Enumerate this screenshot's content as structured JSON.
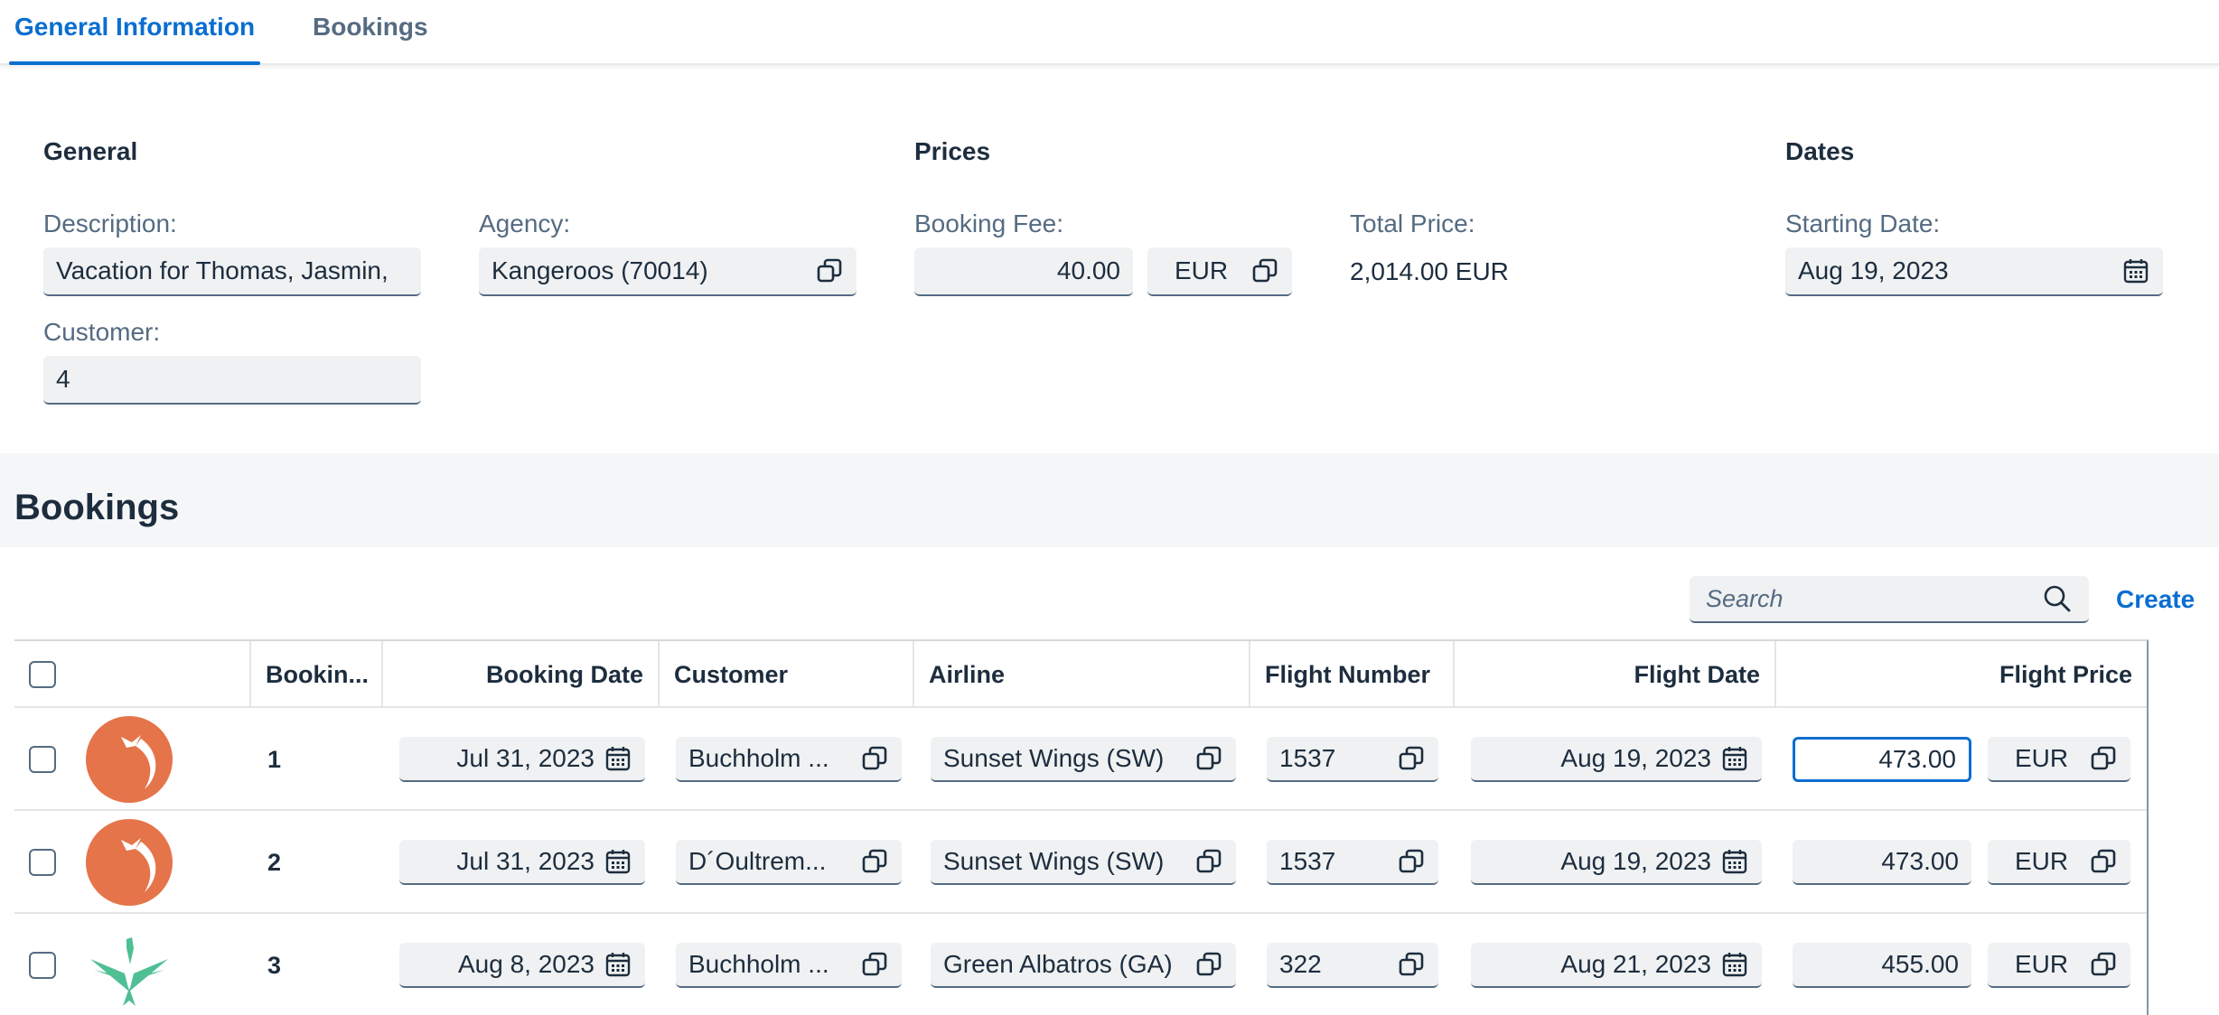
{
  "tabs": {
    "general": "General Information",
    "bookings": "Bookings"
  },
  "form": {
    "general_title": "General",
    "prices_title": "Prices",
    "dates_title": "Dates",
    "description_label": "Description:",
    "description_value": "Vacation for Thomas, Jasmin,",
    "agency_label": "Agency:",
    "agency_value": "Kangeroos (70014)",
    "customer_label": "Customer:",
    "customer_value": "4",
    "booking_fee_label": "Booking Fee:",
    "booking_fee_value": "40.00",
    "booking_fee_currency": "EUR",
    "total_price_label": "Total Price:",
    "total_price_value": "2,014.00 EUR",
    "starting_date_label": "Starting Date:",
    "starting_date_value": "Aug 19, 2023"
  },
  "bookings": {
    "title": "Bookings",
    "search_placeholder": "Search",
    "create_label": "Create",
    "columns": [
      "Bookin...",
      "Booking Date",
      "Customer",
      "Airline",
      "Flight Number",
      "Flight Date",
      "Flight Price"
    ],
    "rows": [
      {
        "id": "1",
        "logo": "sunset-wings-logo",
        "booking_date": "Jul 31, 2023",
        "customer": "Buchholm ...",
        "airline": "Sunset Wings (SW)",
        "flight_number": "1537",
        "flight_date": "Aug 19, 2023",
        "flight_price": "473.00",
        "currency": "EUR"
      },
      {
        "id": "2",
        "logo": "sunset-wings-logo",
        "booking_date": "Jul 31, 2023",
        "customer": "D´Oultrem...",
        "airline": "Sunset Wings (SW)",
        "flight_number": "1537",
        "flight_date": "Aug 19, 2023",
        "flight_price": "473.00",
        "currency": "EUR"
      },
      {
        "id": "3",
        "logo": "green-albatros-logo",
        "booking_date": "Aug 8, 2023",
        "customer": "Buchholm ...",
        "airline": "Green Albatros (GA)",
        "flight_number": "322",
        "flight_date": "Aug 21, 2023",
        "flight_price": "455.00",
        "currency": "EUR"
      }
    ]
  },
  "colors": {
    "accent": "#0a6ed1",
    "label": "#556b82",
    "text": "#1d2d3e",
    "field_bg": "#eff1f2",
    "sunset_logo": "#e5744a",
    "albatros_logo": "#4fbf94"
  },
  "icons": {
    "value_help": "value-help-icon",
    "calendar": "calendar-icon",
    "search": "search-icon"
  }
}
